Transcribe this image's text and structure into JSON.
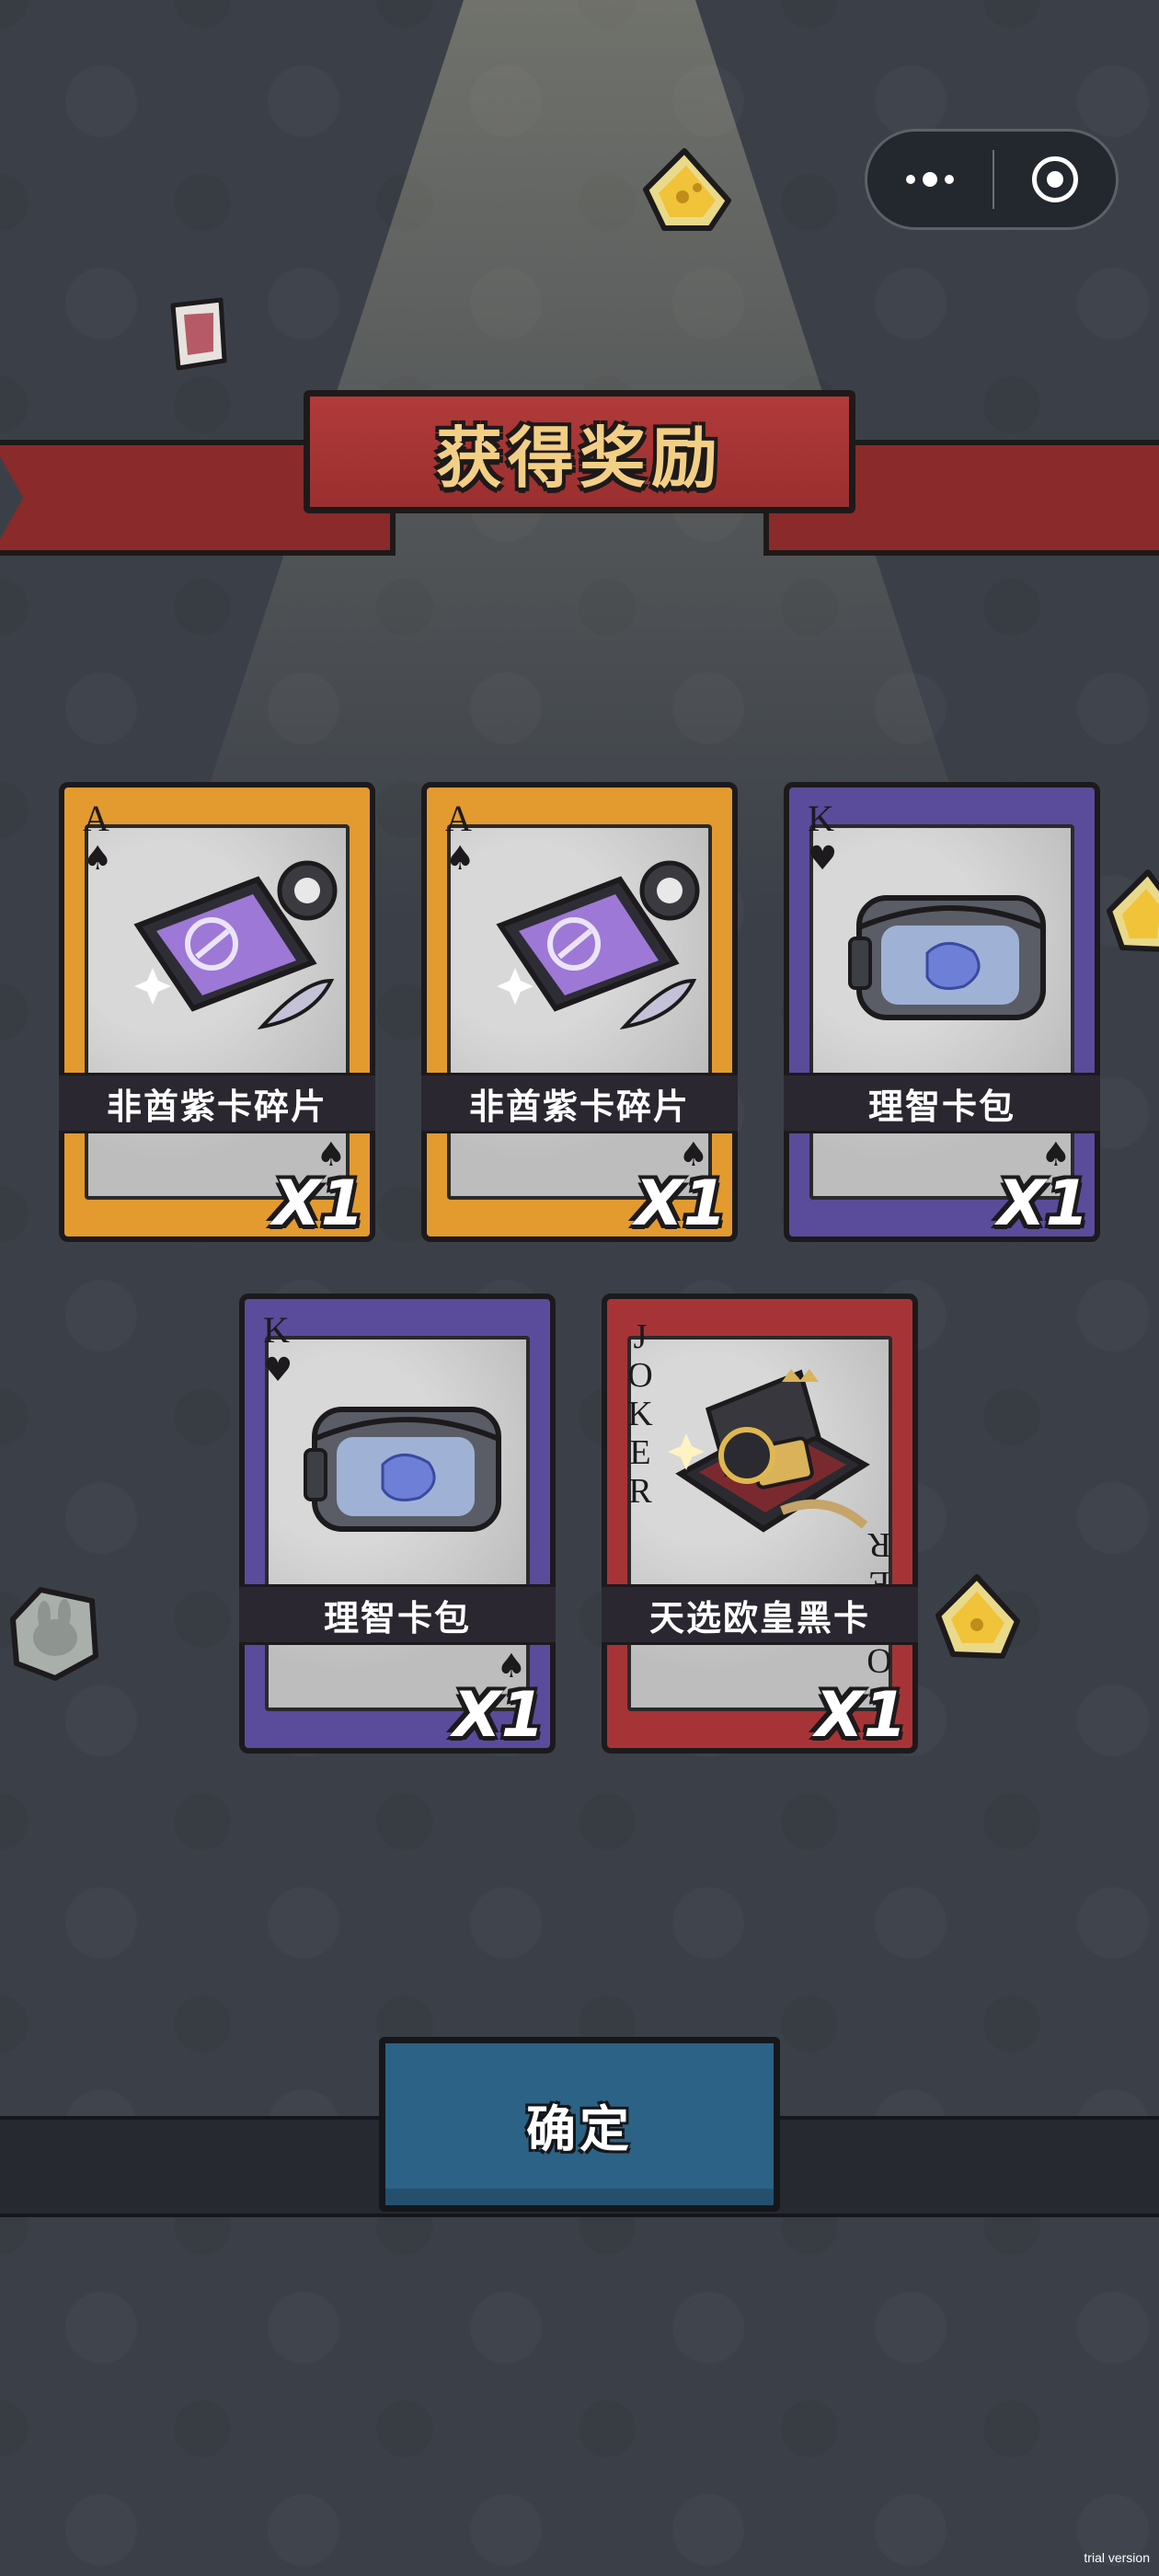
{
  "header": {
    "title": "获得奖励",
    "menu_icon": "more-dots-icon",
    "close_icon": "target-close-icon"
  },
  "rewards": [
    {
      "name": "非酋紫卡碎片",
      "quantity": "X1",
      "rank": "A",
      "suit": "♠",
      "frame": "gold",
      "icon": "purple-card-fragment-icon"
    },
    {
      "name": "非酋紫卡碎片",
      "quantity": "X1",
      "rank": "A",
      "suit": "♠",
      "frame": "gold",
      "icon": "purple-card-fragment-icon"
    },
    {
      "name": "理智卡包",
      "quantity": "X1",
      "rank": "K",
      "suit": "♥",
      "frame": "purple",
      "icon": "card-pouch-icon"
    },
    {
      "name": "理智卡包",
      "quantity": "X1",
      "rank": "K",
      "suit": "♥",
      "frame": "purple",
      "icon": "card-pouch-icon"
    },
    {
      "name": "天选欧皇黑卡",
      "quantity": "X1",
      "rank": "JOKER",
      "suit": "",
      "frame": "red",
      "icon": "black-card-box-icon"
    }
  ],
  "footer": {
    "confirm_label": "确定",
    "watermark": "trial version"
  },
  "colors": {
    "background": "#3b4048",
    "banner": "#9b2f2f",
    "banner_text": "#f3cf85",
    "gold_frame": "#e39a2e",
    "purple_frame": "#5b4b9b",
    "red_frame": "#a63437",
    "confirm_button": "#2c6285"
  }
}
